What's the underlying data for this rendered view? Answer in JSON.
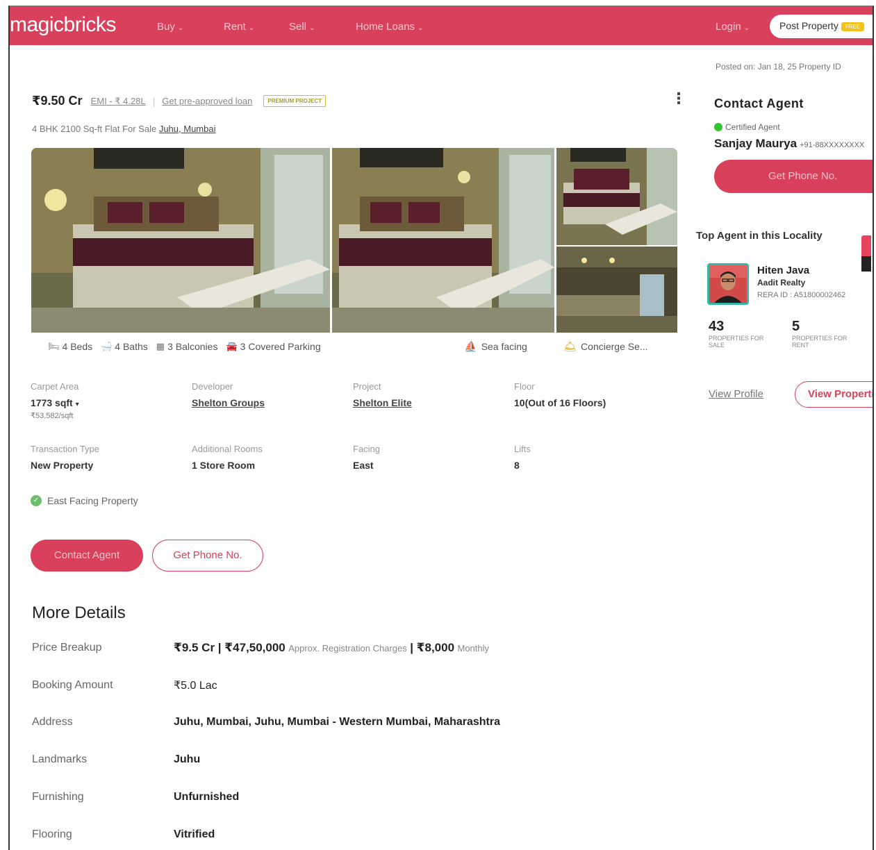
{
  "nav": {
    "logo": "magicbricks",
    "items": [
      "Buy",
      "Rent",
      "Sell",
      "Home Loans"
    ],
    "login": "Login",
    "post_property": "Post Property",
    "post_tag": "FREE"
  },
  "meta": {
    "posted": "Posted on: Jan 18, 25      Property ID"
  },
  "listing": {
    "price": "₹9.50 Cr",
    "emi": "EMI - ₹ 4.28L",
    "preapproved": "Get pre-approved loan",
    "badge": "PREMIUM PROJECT",
    "subtitle_prefix": "4 BHK 2100 Sq-ft Flat For Sale",
    "subtitle_locality": "Juhu, Mumbai"
  },
  "amenities": {
    "beds": "4 Beds",
    "baths": "4 Baths",
    "balconies": "3 Balconies",
    "parking": "3 Covered Parking",
    "sea": "Sea facing",
    "concierge": "Concierge Se..."
  },
  "specs": {
    "carpet_label": "Carpet Area",
    "carpet_value": "1773 sqft",
    "carpet_rate": "₹53,582/sqft",
    "developer_label": "Developer",
    "developer_value": "Shelton Groups",
    "project_label": "Project",
    "project_value": "Shelton Elite",
    "floor_label": "Floor",
    "floor_value": "10(Out of 16 Floors)",
    "transaction_label": "Transaction Type",
    "transaction_value": "New Property",
    "rooms_label": "Additional Rooms",
    "rooms_value": "1 Store Room",
    "facing_label": "Facing",
    "facing_value": "East",
    "lifts_label": "Lifts",
    "lifts_value": "8"
  },
  "feature": "East Facing Property",
  "actions": {
    "contact": "Contact Agent",
    "phone": "Get Phone No."
  },
  "more_details": {
    "title": "More Details",
    "price_label": "Price Breakup",
    "price_value": "₹9.5 Cr | ₹47,50,000",
    "price_reg": "Approx. Registration Charges",
    "price_monthly_value": "| ₹8,000",
    "price_monthly": "Monthly",
    "booking_label": "Booking Amount",
    "booking_value": "₹5.0 Lac",
    "address_label": "Address",
    "address_value": "Juhu, Mumbai, Juhu, Mumbai - Western Mumbai, Maharashtra",
    "landmarks_label": "Landmarks",
    "landmarks_value": "Juhu",
    "furnishing_label": "Furnishing",
    "furnishing_value": "Unfurnished",
    "flooring_label": "Flooring",
    "flooring_value": "Vitrified"
  },
  "sidebar": {
    "title": "Contact Agent",
    "certified": "Certified Agent",
    "agent_name": "Sanjay Maurya",
    "agent_phone": "+91-88XXXXXXXX",
    "phone_btn": "Get Phone No.",
    "top_agent_title": "Top Agent in this Locality",
    "top_agent_name": "Hiten Java",
    "top_agent_firm": "Aadit Realty",
    "top_agent_rera": "RERA ID : A51800002462",
    "sale_count": "43",
    "sale_label": "PROPERTIES FOR SALE",
    "rent_count": "5",
    "rent_label": "PROPERTIES FOR RENT",
    "view_profile": "View Profile",
    "view_properties": "View Properties"
  }
}
